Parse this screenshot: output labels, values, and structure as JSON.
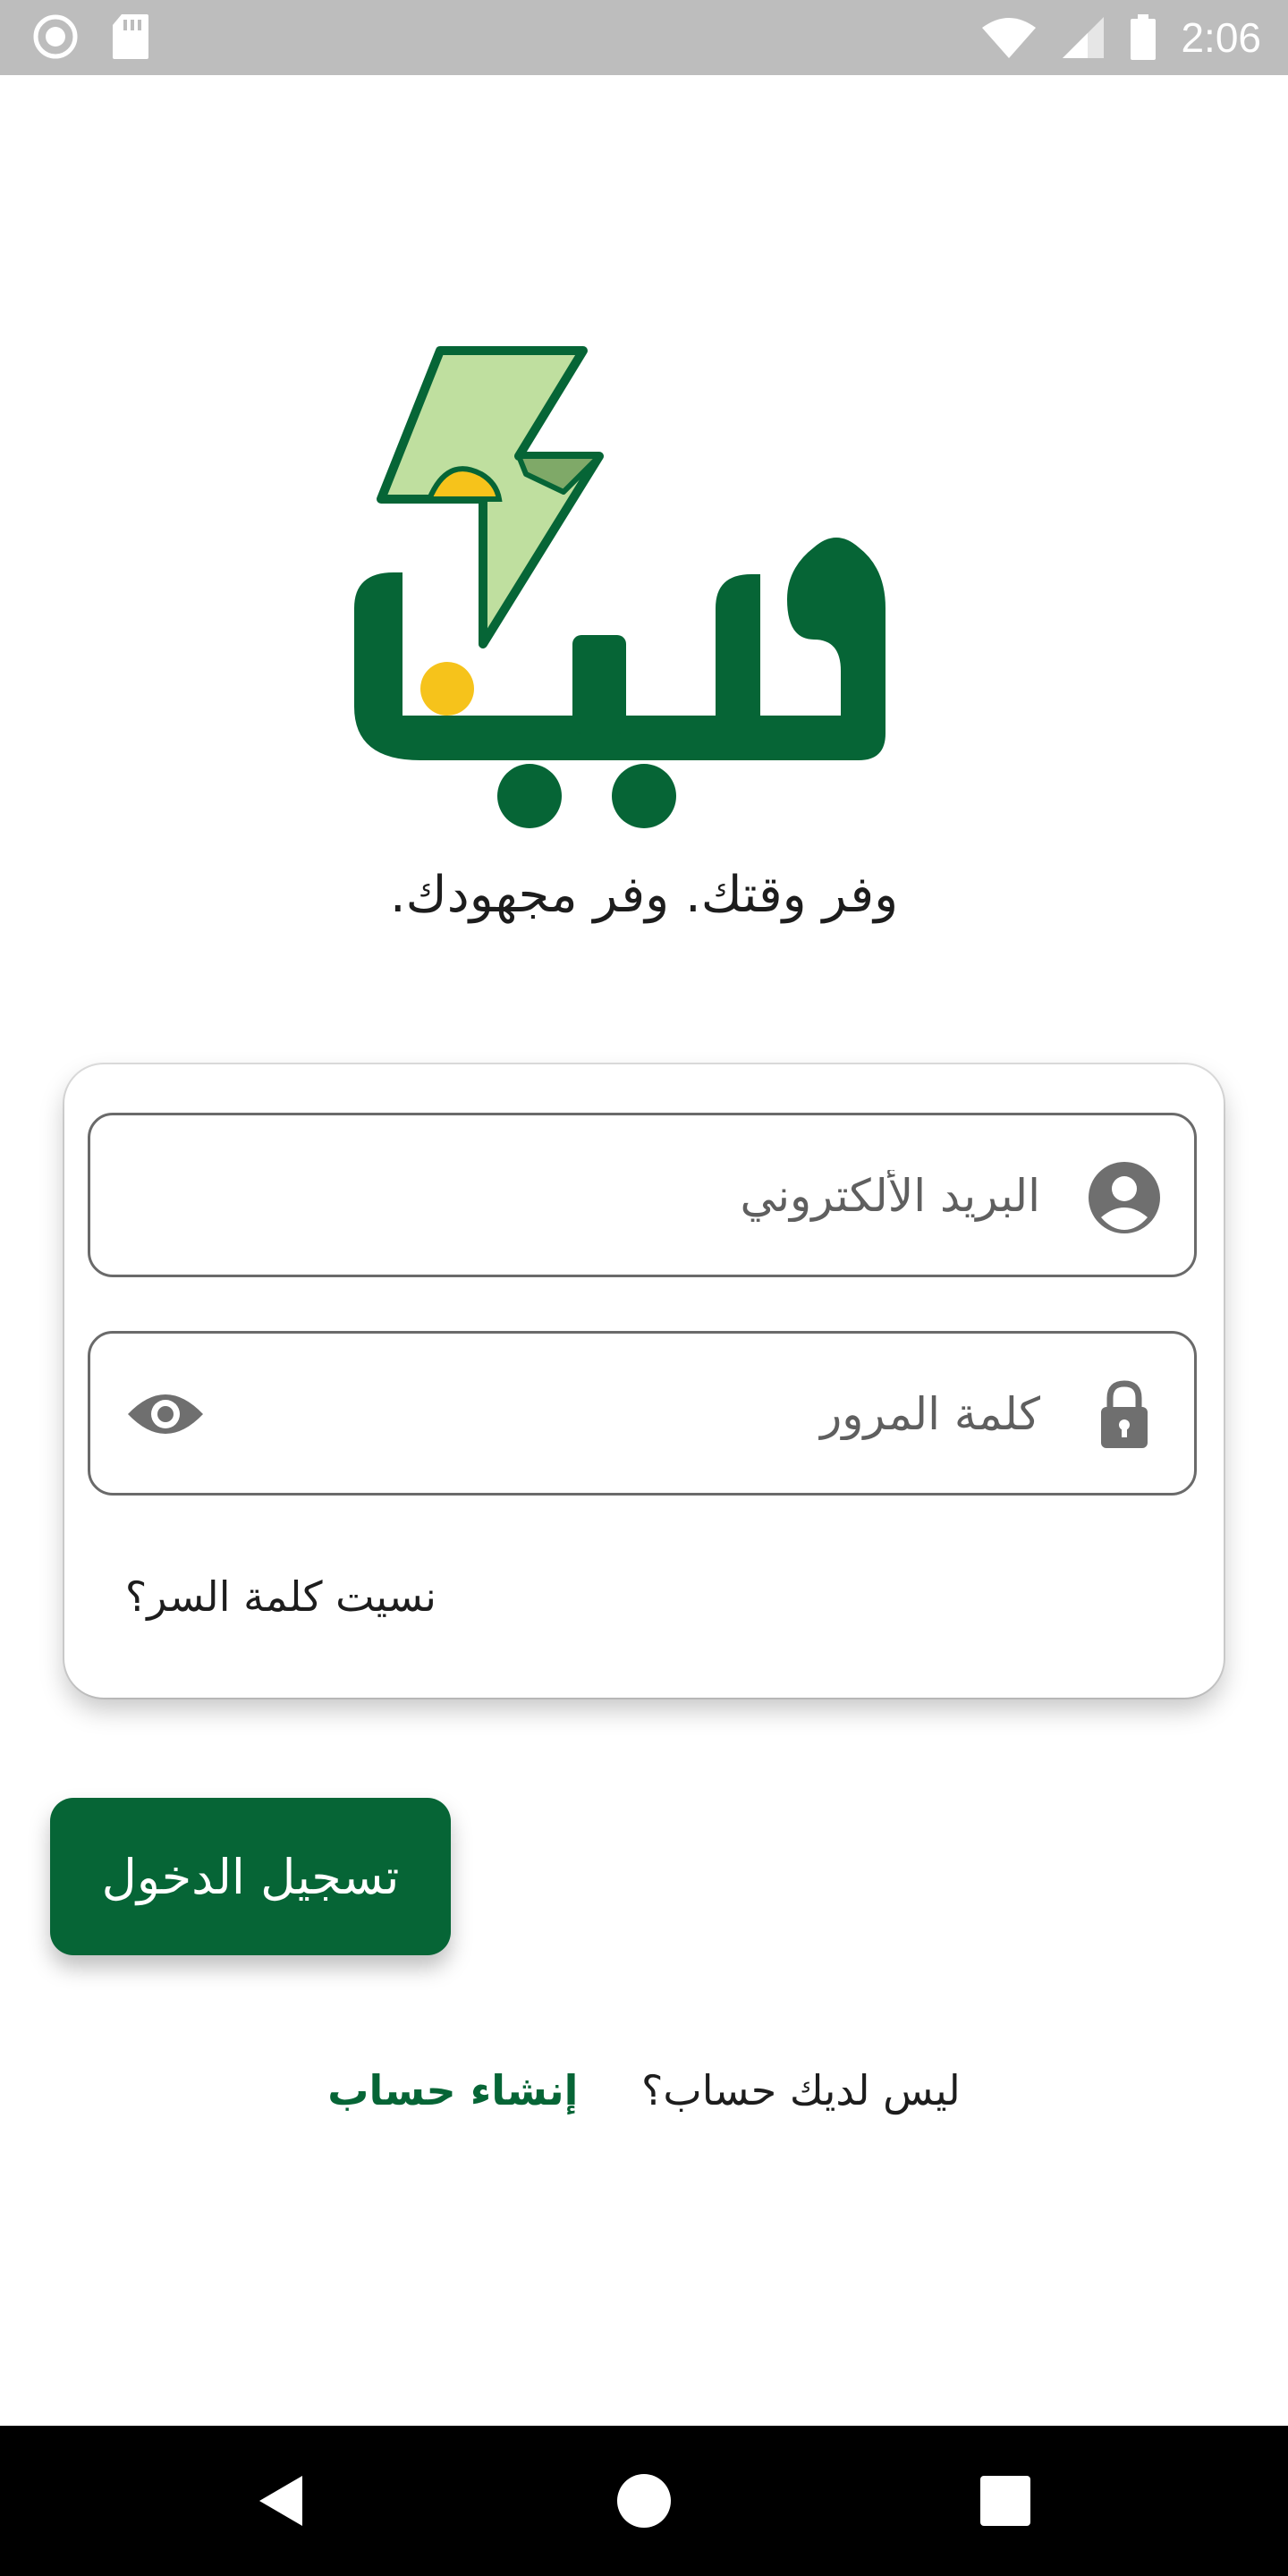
{
  "status_bar": {
    "time": "2:06",
    "icons": [
      "record-icon",
      "sd-card-icon",
      "wifi-icon",
      "signal-icon",
      "battery-icon"
    ]
  },
  "app": {
    "logo_text": "فين",
    "tagline": "وفر وقتك. وفر مجهودك.",
    "brand_color": "#066536",
    "accent_color": "#f6c31b",
    "light_green": "#bfdf9f"
  },
  "login_form": {
    "email_placeholder": "البريد الألكتروني",
    "password_placeholder": "كلمة المرور",
    "forgot_password": "نسيت كلمة السر؟",
    "login_button": "تسجيل الدخول"
  },
  "signup": {
    "question": "ليس لديك حساب؟",
    "link": "إنشاء حساب"
  },
  "nav_bar": {
    "buttons": [
      "back-icon",
      "home-icon",
      "recents-icon"
    ]
  }
}
